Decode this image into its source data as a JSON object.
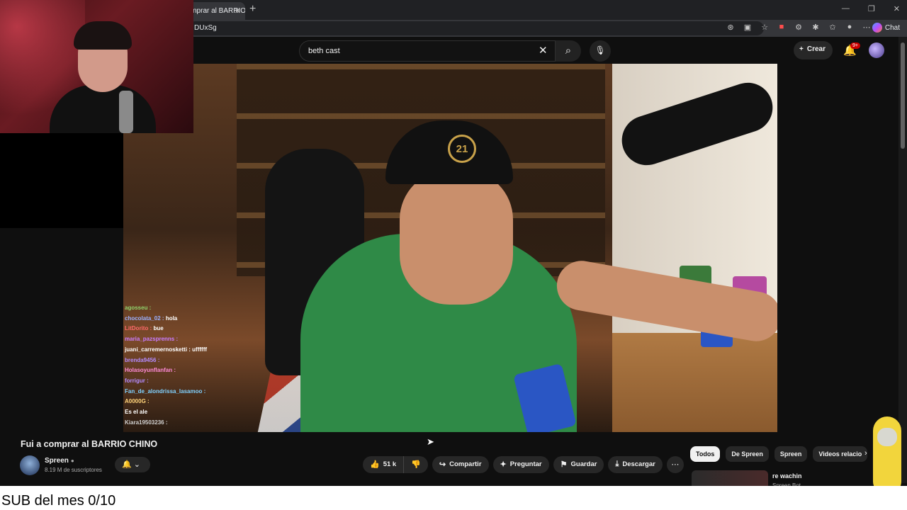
{
  "browser": {
    "tab_title": "nprar al BARRIO",
    "url": "DUxSg",
    "chat_label": "Chat"
  },
  "youtube": {
    "search": {
      "value": "beth cast"
    },
    "create_label": "Crear",
    "notifications_badge": "9+"
  },
  "stream_chat": [
    {
      "user": "agosseu :",
      "msg": "",
      "color": "#8fd16b"
    },
    {
      "user": "chocolata_02 :",
      "msg": "hola",
      "color": "#9ab0ff"
    },
    {
      "user": "LitDorito :",
      "msg": "bue",
      "color": "#ff6a6a"
    },
    {
      "user": "maria_pazsprenns :",
      "msg": "",
      "color": "#c87cff"
    },
    {
      "user": "juani_carremernosketti :",
      "msg": "uffffff",
      "color": "#ffffff"
    },
    {
      "user": "brenda9456 :",
      "msg": "",
      "color": "#b48bff"
    },
    {
      "user": "Holasoyunflanfan :",
      "msg": "",
      "color": "#ff8ad8"
    },
    {
      "user": "forrigur :",
      "msg": "",
      "color": "#b48bff"
    },
    {
      "user": "Fan_de_alondrissa_lasamoo :",
      "msg": "",
      "color": "#7fd1ff"
    },
    {
      "user": "A0000G :",
      "msg": "",
      "color": "#ffd37a"
    },
    {
      "user": "",
      "msg": "Es el ale",
      "color": "#ff4a4a"
    },
    {
      "user": "Kiara19503236 :",
      "msg": "",
      "color": "#d0d0d0"
    }
  ],
  "video": {
    "title": "Fui a comprar al BARRIO CHINO",
    "channel": "Spreen",
    "subscribers": "8.19 M de suscriptores",
    "cap_text": "21"
  },
  "actions": {
    "likes": "51 k",
    "share": "Compartir",
    "ask": "Preguntar",
    "save": "Guardar",
    "download": "Descargar"
  },
  "chips": [
    "Todos",
    "De Spreen",
    "Spreen",
    "Videos relacio"
  ],
  "related": {
    "title": "re wachin",
    "channel": "Spreen Bot"
  },
  "overlay_text": "SUB del mes 0/10",
  "colors": {
    "accent": "#cc0000",
    "background": "#0f0f0f"
  }
}
